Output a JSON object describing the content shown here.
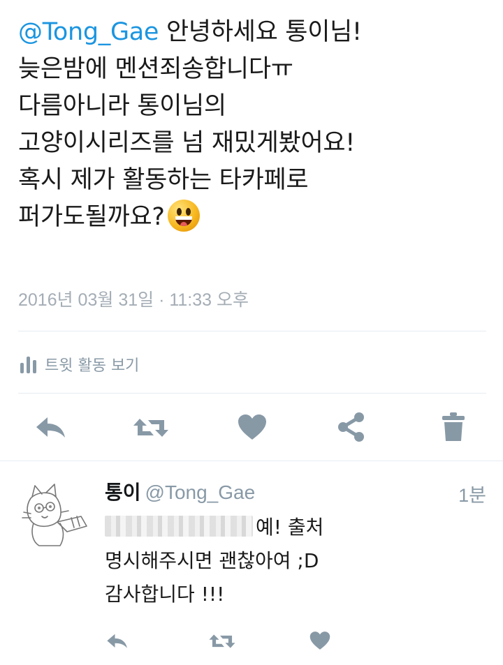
{
  "tweet": {
    "mention": "@Tong_Gae",
    "line1_rest": " 안녕하세요 통이님!",
    "line2": "늦은밤에 멘션죄송합니다ㅠ",
    "line3": "다름아니라 통이님의",
    "line4": "고양이시리즈를 넘 재밌게봤어요!",
    "line5": "혹시 제가 활동하는 타카페로",
    "line6": "퍼가도될까요?",
    "emoji": "grinning-face-emoji",
    "timestamp": "2016년 03월 31일 · 11:33 오후",
    "activity_label": "트윗 활동 보기"
  },
  "actions": [
    "reply-icon",
    "retweet-icon",
    "like-icon",
    "share-icon",
    "delete-icon"
  ],
  "reply": {
    "name": "통이",
    "handle": "@Tong_Gae",
    "time": "1분",
    "line1_rest": "예! 출처",
    "line2": "명시해주시면 괜찮아여 ;D",
    "line3": "감사합니다 !!!",
    "actions": [
      "reply-icon",
      "retweet-icon",
      "like-icon"
    ]
  },
  "colors": {
    "link": "#1b95e0",
    "icon": "#8899a6",
    "meta": "#a4adb5",
    "divider": "#e6ecf0"
  }
}
